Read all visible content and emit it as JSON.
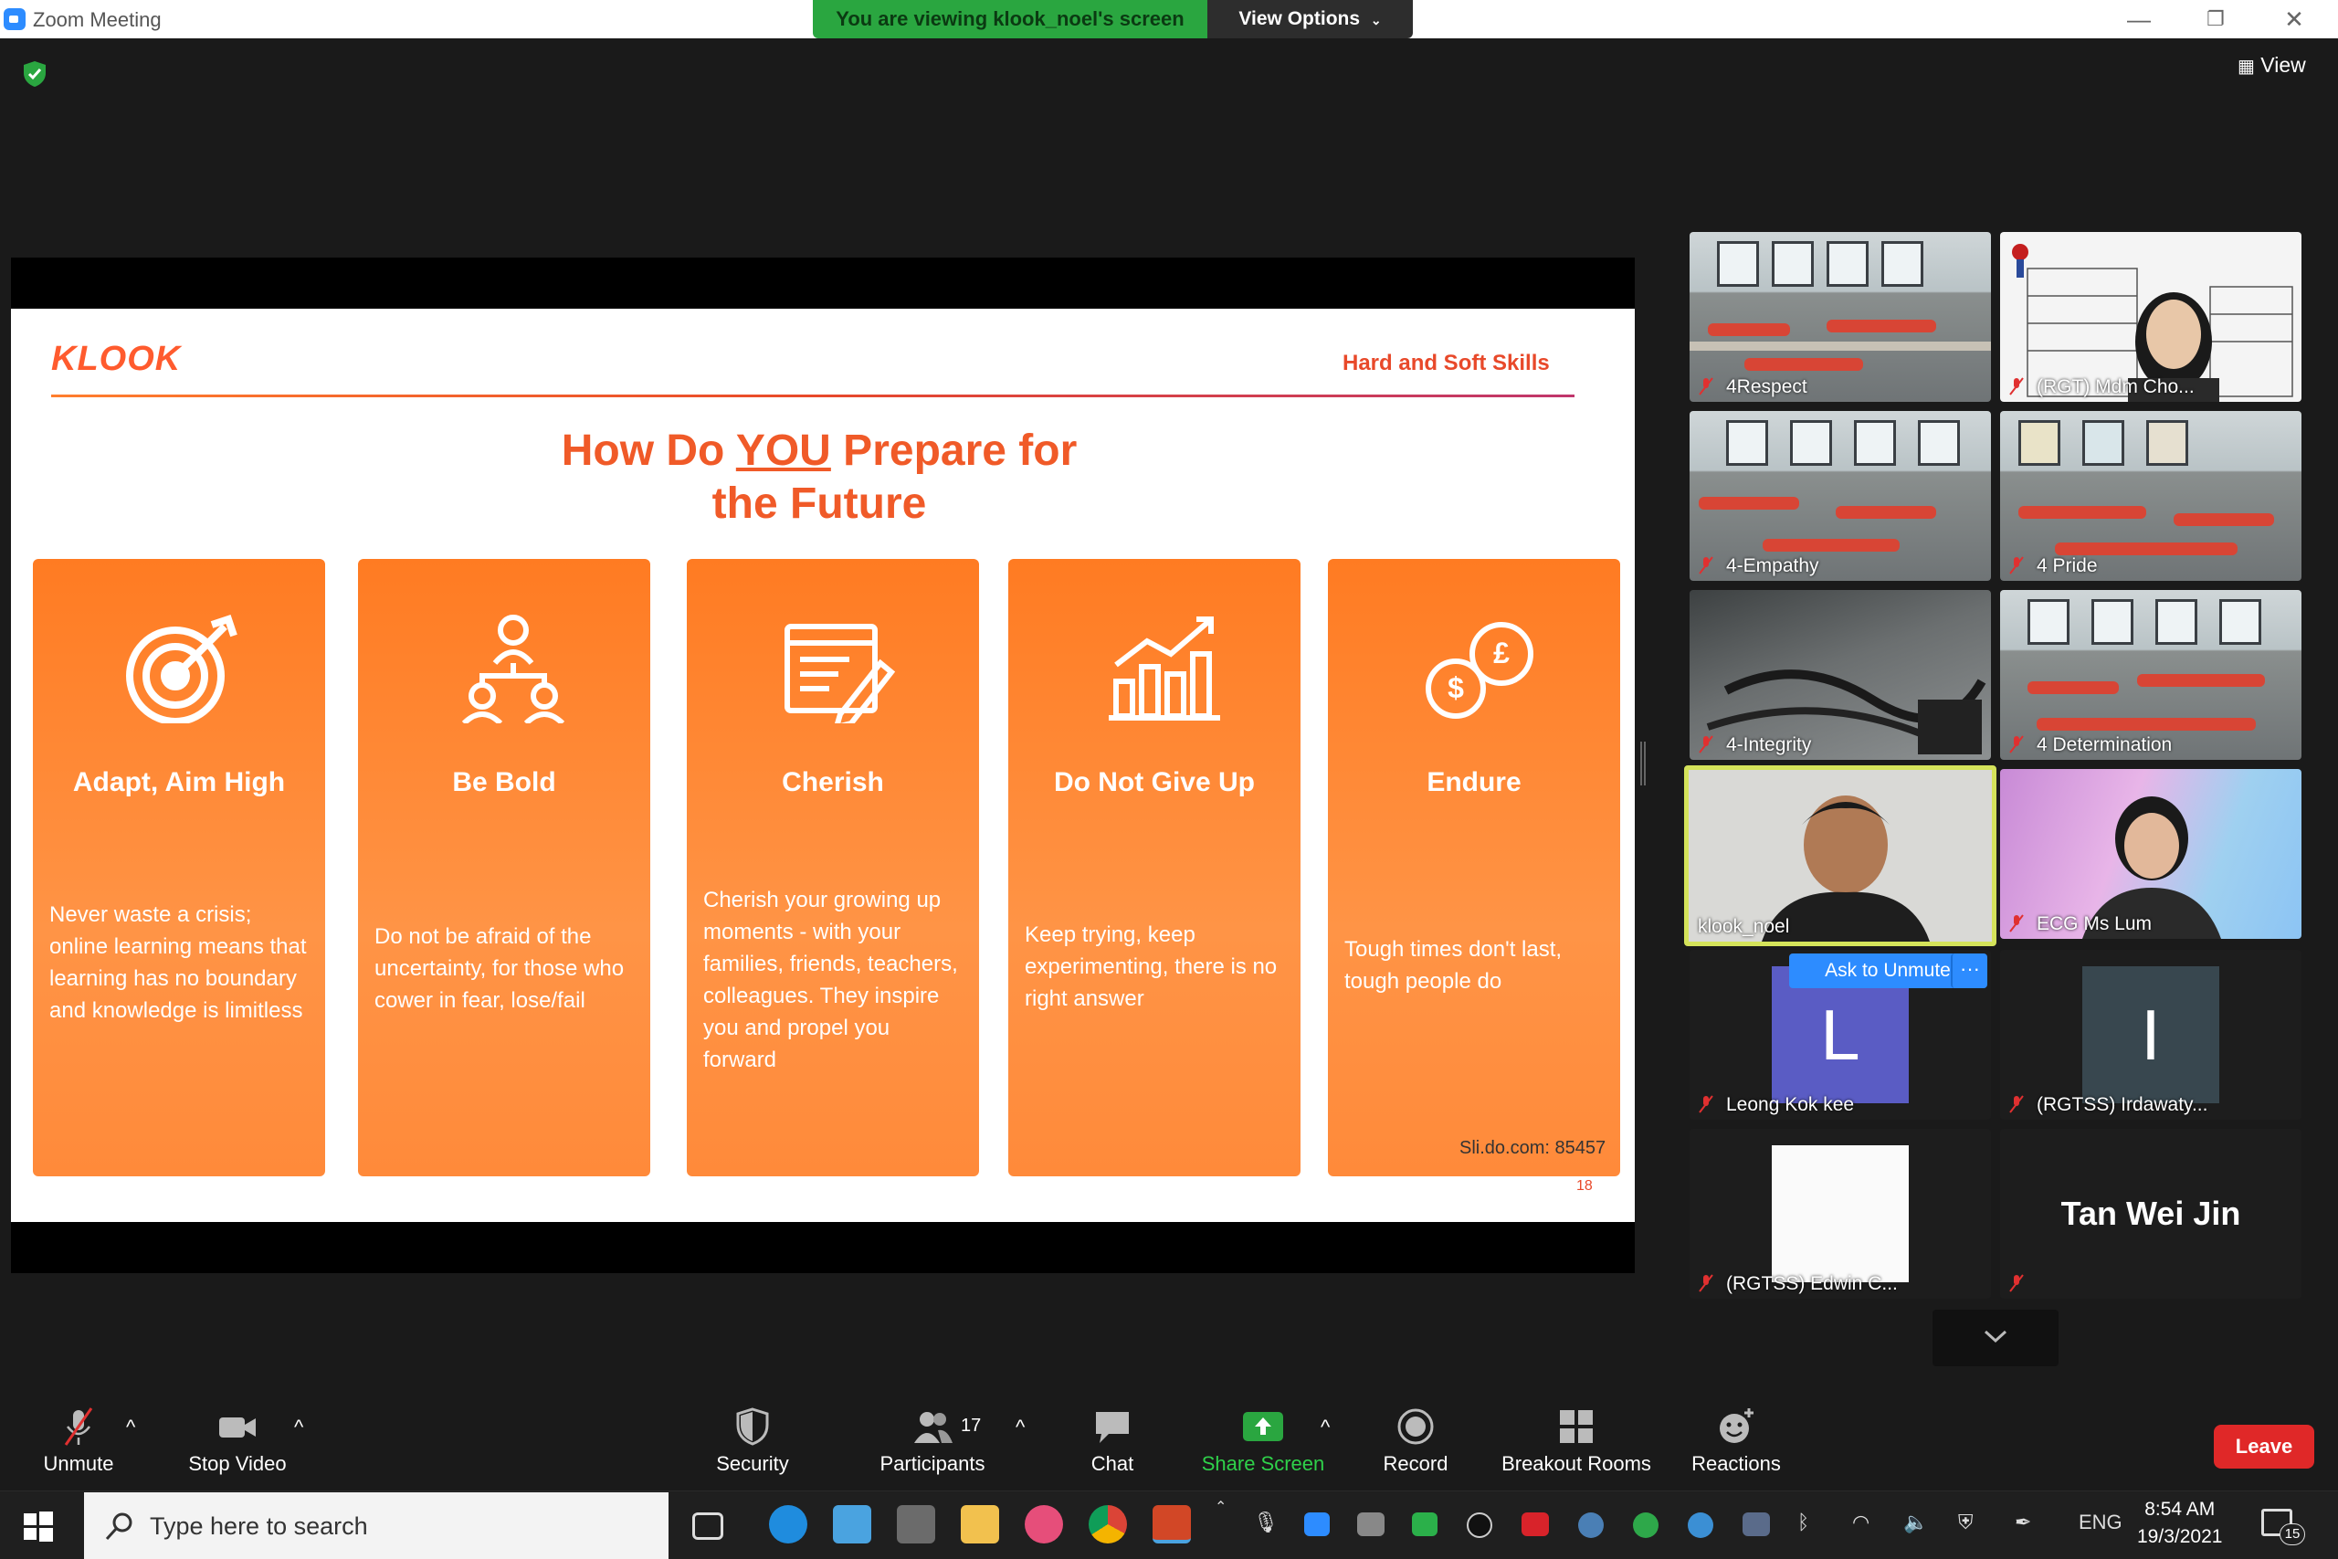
{
  "window": {
    "title": "Zoom Meeting"
  },
  "banner": {
    "viewing": "You are viewing klook_noel's screen",
    "view_options": "View Options"
  },
  "top_right": {
    "view": "View"
  },
  "slide": {
    "logo": "KLOOK",
    "tag": "Hard and Soft Skills",
    "title_line1": "How Do YOU Prepare for",
    "title_line2": "the Future",
    "cards": [
      {
        "heading": "Adapt, Aim High",
        "body": "Never waste a crisis; online learning means that learning has no boundary and knowledge is limitless",
        "icon": "target-icon"
      },
      {
        "heading": "Be Bold",
        "body": "Do not be afraid of the uncertainty, for those who cower in fear, lose/fail",
        "icon": "people-network-icon"
      },
      {
        "heading": "Cherish",
        "body": "Cherish your growing up moments - with your families, friends, teachers, colleagues. They inspire you and propel you forward",
        "icon": "notepad-pen-icon"
      },
      {
        "heading": "Do Not Give Up",
        "body": "Keep trying, keep experimenting, there is no right answer",
        "icon": "bar-growth-icon"
      },
      {
        "heading": "Endure",
        "body": "Tough times don't last, tough people do",
        "icon": "coins-icon"
      }
    ],
    "slido": "Sli.do.com: 85457",
    "page": "18"
  },
  "gallery": {
    "participants": [
      {
        "name": "4Respect",
        "muted": true
      },
      {
        "name": "(RGT) Mdm Cho...",
        "muted": true
      },
      {
        "name": "4-Empathy",
        "muted": true
      },
      {
        "name": "4 Pride",
        "muted": true
      },
      {
        "name": "4-Integrity",
        "muted": true
      },
      {
        "name": "4 Determination",
        "muted": true
      },
      {
        "name": "klook_noel",
        "muted": false,
        "speaking": true
      },
      {
        "name": "ECG Ms Lum",
        "muted": true
      },
      {
        "name": "Leong Kok kee",
        "muted": true,
        "initial": "L"
      },
      {
        "name": "(RGTSS) Irdawaty...",
        "muted": true,
        "initial": "I"
      },
      {
        "name": "(RGTSS) Edwin C...",
        "muted": true
      },
      {
        "name": "Tan Wei Jin",
        "muted": true
      }
    ],
    "ask_to_unmute": "Ask to Unmute",
    "more": "···"
  },
  "toolbar": {
    "unmute": "Unmute",
    "stop_video": "Stop Video",
    "security": "Security",
    "participants": "Participants",
    "participants_count": "17",
    "chat": "Chat",
    "share_screen": "Share Screen",
    "record": "Record",
    "breakout_rooms": "Breakout Rooms",
    "reactions": "Reactions",
    "leave": "Leave",
    "caret": "^"
  },
  "taskbar": {
    "search_placeholder": "Type here to search",
    "language": "ENG",
    "time": "8:54 AM",
    "date": "19/3/2021",
    "notifications": "15"
  },
  "colors": {
    "accent": "#2d8cff",
    "slide_orange": "#ff7b22",
    "leave_red": "#e02828",
    "share_green": "#2aa640"
  }
}
